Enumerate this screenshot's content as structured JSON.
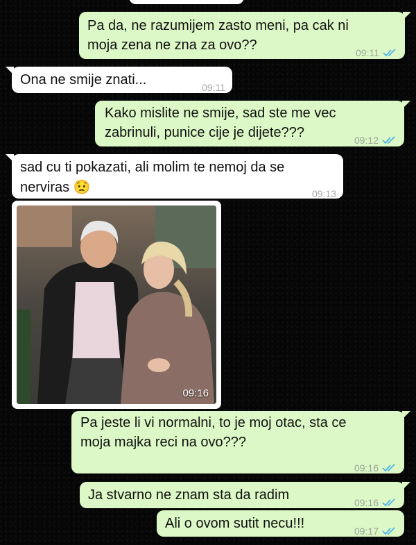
{
  "messages": [
    {
      "id": "m0",
      "direction": "in",
      "text": "",
      "time": ""
    },
    {
      "id": "m1",
      "direction": "out",
      "line1": "Pa da, ne razumijem zasto meni, pa cak ni",
      "line2": "moja zena ne zna za ovo??",
      "time": "09:11",
      "status": "read-ticks-icon"
    },
    {
      "id": "m2",
      "direction": "in",
      "text": "Ona ne smije znati...",
      "time": "09:11"
    },
    {
      "id": "m3",
      "direction": "out",
      "line1": "Kako mislite ne smije, sad ste me vec",
      "line2": "zabrinuli, punice cije je dijete???",
      "time": "09:12",
      "status": "read-ticks-icon"
    },
    {
      "id": "m4",
      "direction": "in",
      "line1": "sad cu ti pokazati, ali molim te nemoj da se",
      "line2": "nerviras",
      "emoji": "😟",
      "time": "09:13"
    },
    {
      "id": "m5",
      "direction": "in",
      "type": "image",
      "image": "photo of elderly couple laughing",
      "time": "09:16"
    },
    {
      "id": "m6",
      "direction": "out",
      "line1": "Pa jeste li vi normalni, to je moj otac, sta ce",
      "line2": "moja majka reci na ovo???",
      "time": "09:16",
      "status": "read-ticks-icon"
    },
    {
      "id": "m7",
      "direction": "out",
      "text": "Ja stvarno ne znam sta da radim",
      "time": "09:16",
      "status": "read-ticks-icon"
    },
    {
      "id": "m8",
      "direction": "out",
      "text": "Ali o ovom sutit necu!!!",
      "time": "09:17",
      "status": "read-ticks-icon"
    }
  ],
  "colors": {
    "outgoing": "#dcf8c6",
    "incoming": "#ffffff",
    "ticks": "#4fb5e8",
    "background": "#060606"
  }
}
